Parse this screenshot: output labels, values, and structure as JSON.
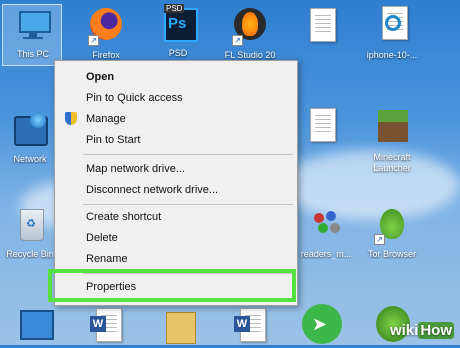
{
  "desktop_icons": [
    {
      "label": "This PC",
      "icon": "this-pc-icon"
    },
    {
      "label": "Firefox",
      "icon": "firefox-icon"
    },
    {
      "label": "PSD",
      "icon": "photoshop-icon"
    },
    {
      "label": "FL Studio 20",
      "icon": "fl-studio-icon"
    },
    {
      "label": "",
      "icon": "document-icon"
    },
    {
      "label": "iphone-10-...",
      "icon": "iphone-file-icon"
    },
    {
      "label": "Network",
      "icon": "network-icon"
    },
    {
      "label": "",
      "icon": "document-icon"
    },
    {
      "label": "Minecraft Launcher",
      "icon": "minecraft-icon"
    },
    {
      "label": "Recycle Bin",
      "icon": "recycle-bin-icon"
    },
    {
      "label": "readers_m...",
      "icon": "readers-file-icon"
    },
    {
      "label": "Tor Browser",
      "icon": "tor-browser-icon"
    },
    {
      "label": "",
      "icon": "control-panel-icon"
    },
    {
      "label": "",
      "icon": "word-document-icon"
    },
    {
      "label": "",
      "icon": "folder-icon"
    },
    {
      "label": "",
      "icon": "word-document-icon"
    },
    {
      "label": "",
      "icon": "send-icon"
    },
    {
      "label": "",
      "icon": "green-app-icon"
    }
  ],
  "psd_badge": "PSD",
  "ps_letters": "Ps",
  "context_menu": {
    "items": [
      {
        "label": "Open",
        "bold": true
      },
      {
        "label": "Pin to Quick access"
      },
      {
        "label": "Manage",
        "icon": "uac-shield-icon"
      },
      {
        "label": "Pin to Start"
      },
      {
        "label": "Map network drive..."
      },
      {
        "label": "Disconnect network drive..."
      },
      {
        "label": "Create shortcut"
      },
      {
        "label": "Delete"
      },
      {
        "label": "Rename"
      },
      {
        "label": "Properties"
      }
    ]
  },
  "watermark": {
    "prefix": "wiki",
    "suffix": "How"
  },
  "colors": {
    "highlight": "#55e240",
    "menu_bg": "#f0f0f0"
  }
}
